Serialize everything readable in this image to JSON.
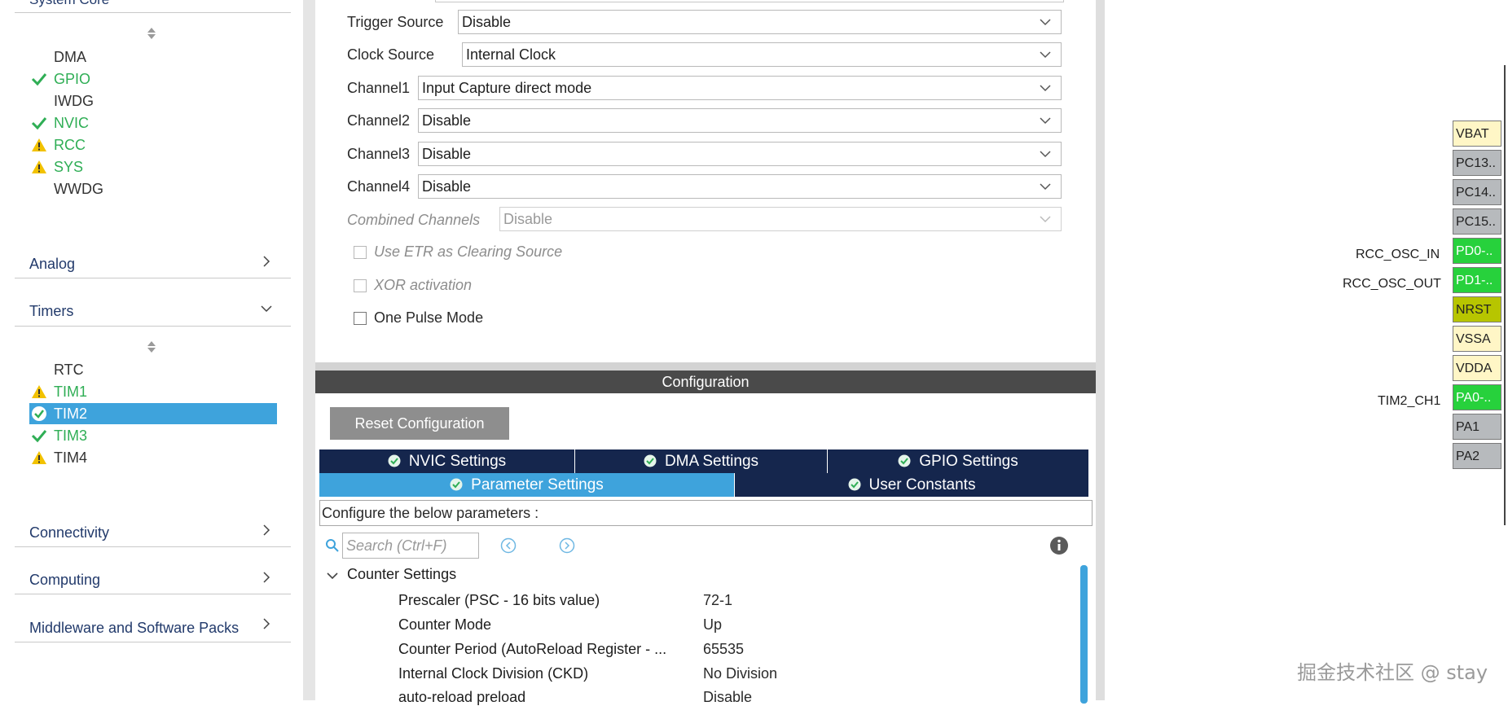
{
  "left_panel": {
    "partial_category": "System Core",
    "system_core_items": [
      {
        "label": "DMA",
        "status": "none"
      },
      {
        "label": "GPIO",
        "status": "ok"
      },
      {
        "label": "IWDG",
        "status": "none"
      },
      {
        "label": "NVIC",
        "status": "ok"
      },
      {
        "label": "RCC",
        "status": "warning"
      },
      {
        "label": "SYS",
        "status": "warning"
      },
      {
        "label": "WWDG",
        "status": "none"
      }
    ],
    "categories": {
      "analog": "Analog",
      "timers": "Timers",
      "connectivity": "Connectivity",
      "computing": "Computing",
      "middleware": "Middleware and Software Packs"
    },
    "timer_items": [
      {
        "label": "RTC",
        "status": "none"
      },
      {
        "label": "TIM1",
        "status": "warning"
      },
      {
        "label": "TIM2",
        "status": "ok",
        "selected": true
      },
      {
        "label": "TIM3",
        "status": "ok"
      },
      {
        "label": "TIM4",
        "status": "warning"
      }
    ]
  },
  "mode": {
    "trigger_source": {
      "label": "Trigger Source",
      "value": "Disable"
    },
    "clock_source": {
      "label": "Clock Source",
      "value": "Internal Clock"
    },
    "channel1": {
      "label": "Channel1",
      "value": "Input Capture direct mode"
    },
    "channel2": {
      "label": "Channel2",
      "value": "Disable"
    },
    "channel3": {
      "label": "Channel3",
      "value": "Disable"
    },
    "channel4": {
      "label": "Channel4",
      "value": "Disable"
    },
    "combined": {
      "label": "Combined Channels",
      "value": "Disable"
    },
    "use_etr": "Use ETR as Clearing Source",
    "xor": "XOR activation",
    "one_pulse": "One Pulse Mode"
  },
  "configuration": {
    "header": "Configuration",
    "reset_button": "Reset Configuration",
    "tabs": {
      "nvic": "NVIC Settings",
      "dma": "DMA Settings",
      "gpio": "GPIO Settings",
      "parameter": "Parameter Settings",
      "user_constants": "User Constants"
    },
    "param_caption": "Configure the below parameters :",
    "search_placeholder": "Search (Ctrl+F)",
    "group": "Counter Settings",
    "params": [
      {
        "name": "Prescaler (PSC - 16 bits value)",
        "value": "72-1"
      },
      {
        "name": "Counter Mode",
        "value": "Up"
      },
      {
        "name": "Counter Period (AutoReload Register - ...",
        "value": "65535"
      },
      {
        "name": "Internal Clock Division (CKD)",
        "value": "No Division"
      },
      {
        "name": "auto-reload preload",
        "value": "Disable"
      }
    ]
  },
  "pinout": {
    "pins": [
      {
        "name": "VBAT",
        "kind": "power"
      },
      {
        "name": "PC13..",
        "kind": "gray"
      },
      {
        "name": "PC14..",
        "kind": "gray"
      },
      {
        "name": "PC15..",
        "kind": "gray"
      },
      {
        "name": "PD0-..",
        "kind": "green"
      },
      {
        "name": "PD1-..",
        "kind": "green"
      },
      {
        "name": "NRST",
        "kind": "olive"
      },
      {
        "name": "VSSA",
        "kind": "power"
      },
      {
        "name": "VDDA",
        "kind": "power"
      },
      {
        "name": "PA0-..",
        "kind": "green"
      },
      {
        "name": "PA1",
        "kind": "gray"
      },
      {
        "name": "PA2",
        "kind": "gray"
      }
    ],
    "labels": {
      "rcc_osc_in": "RCC_OSC_IN",
      "rcc_osc_out": "RCC_OSC_OUT",
      "tim2_ch1": "TIM2_CH1"
    }
  },
  "watermark": "掘金技术社区 @ stay",
  "colors": {
    "ok": "#2fae55",
    "warning": "#f2c200",
    "selected": "#3ea3dc",
    "tab_dark": "#15264d"
  }
}
